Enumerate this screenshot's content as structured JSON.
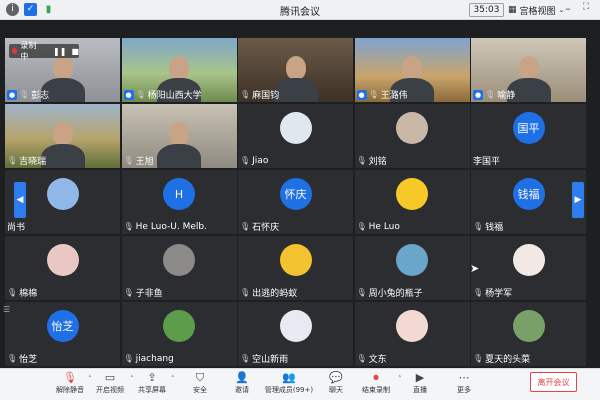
{
  "window": {
    "title": "腾讯会议",
    "timer": "35:03",
    "view_label": "宫格视图"
  },
  "recording": {
    "label": "录制中"
  },
  "tiles": [
    {
      "name": "彭志",
      "host": true
    },
    {
      "name": "杨阳山西大学",
      "host": true
    },
    {
      "name": "麻国钧",
      "host": false
    },
    {
      "name": "王潞伟",
      "host": true
    },
    {
      "name": "喻静",
      "host": true
    },
    {
      "name": "吉晓瑞",
      "host": false
    },
    {
      "name": "王旭",
      "host": false
    },
    {
      "name": "Jiao",
      "host": false
    },
    {
      "name": "刘铭",
      "host": false
    },
    {
      "name": "李国平",
      "host": false,
      "avatar_text": "国平"
    },
    {
      "name": "尚书",
      "host": false
    },
    {
      "name": "He Luo-U. Melb.",
      "host": false,
      "avatar_text": "H"
    },
    {
      "name": "石怀庆",
      "host": false,
      "avatar_text": "怀庆"
    },
    {
      "name": "He Luo",
      "host": false
    },
    {
      "name": "钱福",
      "host": false,
      "avatar_text": "钱福"
    },
    {
      "name": "棉棉",
      "host": false
    },
    {
      "name": "子非鱼",
      "host": false
    },
    {
      "name": "出逃的蚂蚁",
      "host": false
    },
    {
      "name": "周小兔的瓶子",
      "host": false
    },
    {
      "name": "杨学军",
      "host": false
    },
    {
      "name": "怡芝",
      "host": false,
      "avatar_text": "怡芝"
    },
    {
      "name": "jiachang",
      "host": false
    },
    {
      "name": "空山新雨",
      "host": false
    },
    {
      "name": "文东",
      "host": false
    },
    {
      "name": "夏天的头菜",
      "host": false
    }
  ],
  "toolbar": {
    "mute": "解除静音",
    "video": "开启视频",
    "share": "共享屏幕",
    "security": "安全",
    "invite": "邀请",
    "members": "管理成员(99+)",
    "chat": "聊天",
    "record": "结束录制",
    "live": "直播",
    "more": "更多",
    "leave": "离开会议"
  },
  "colors": {
    "accent": "#1f6fe5",
    "leave": "#e04646",
    "tile_bg": "#2b2d31"
  }
}
